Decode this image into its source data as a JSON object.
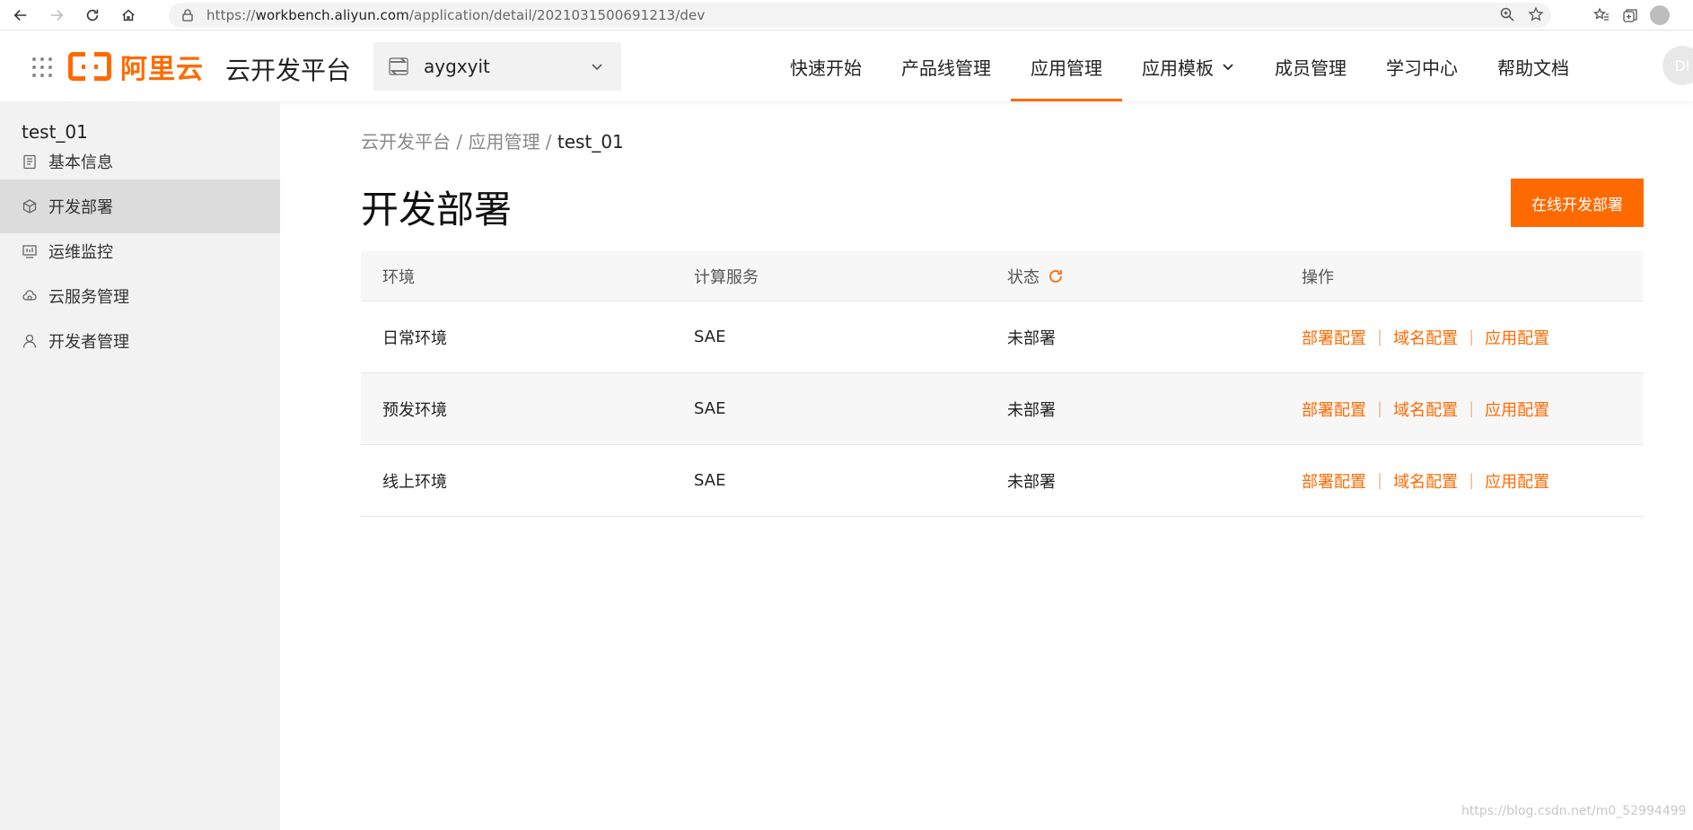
{
  "browser": {
    "url_prefix": "https://",
    "url_host": "workbench.aliyun.com",
    "url_path": "/application/detail/2021031500691213/dev"
  },
  "header": {
    "logo_text": "阿里云",
    "platform_name": "云开发平台",
    "project_name": "aygxyit",
    "nav": [
      {
        "label": "快速开始"
      },
      {
        "label": "产品线管理"
      },
      {
        "label": "应用管理"
      },
      {
        "label": "应用模板"
      },
      {
        "label": "成员管理"
      },
      {
        "label": "学习中心"
      },
      {
        "label": "帮助文档"
      }
    ],
    "user_initials": "DI"
  },
  "sidebar": {
    "app_name": "test_01",
    "items": [
      {
        "label": "基本信息",
        "icon": "clipboard-icon"
      },
      {
        "label": "开发部署",
        "icon": "cube-icon"
      },
      {
        "label": "运维监控",
        "icon": "monitor-icon"
      },
      {
        "label": "云服务管理",
        "icon": "cloud-icon"
      },
      {
        "label": "开发者管理",
        "icon": "user-icon"
      }
    ]
  },
  "main": {
    "breadcrumb": {
      "part1": "云开发平台",
      "sep": " / ",
      "part2": "应用管理",
      "current": "test_01"
    },
    "title": "开发部署",
    "primary_button": "在线开发部署",
    "table": {
      "headers": [
        "环境",
        "计算服务",
        "状态",
        "操作"
      ],
      "rows": [
        {
          "env": "日常环境",
          "service": "SAE",
          "status": "未部署"
        },
        {
          "env": "预发环境",
          "service": "SAE",
          "status": "未部署"
        },
        {
          "env": "线上环境",
          "service": "SAE",
          "status": "未部署"
        }
      ],
      "actions": [
        "部署配置",
        "域名配置",
        "应用配置"
      ],
      "action_sep": "|"
    }
  },
  "watermark": "https://blog.csdn.net/m0_52994499",
  "colors": {
    "accent": "#ff6a00"
  }
}
